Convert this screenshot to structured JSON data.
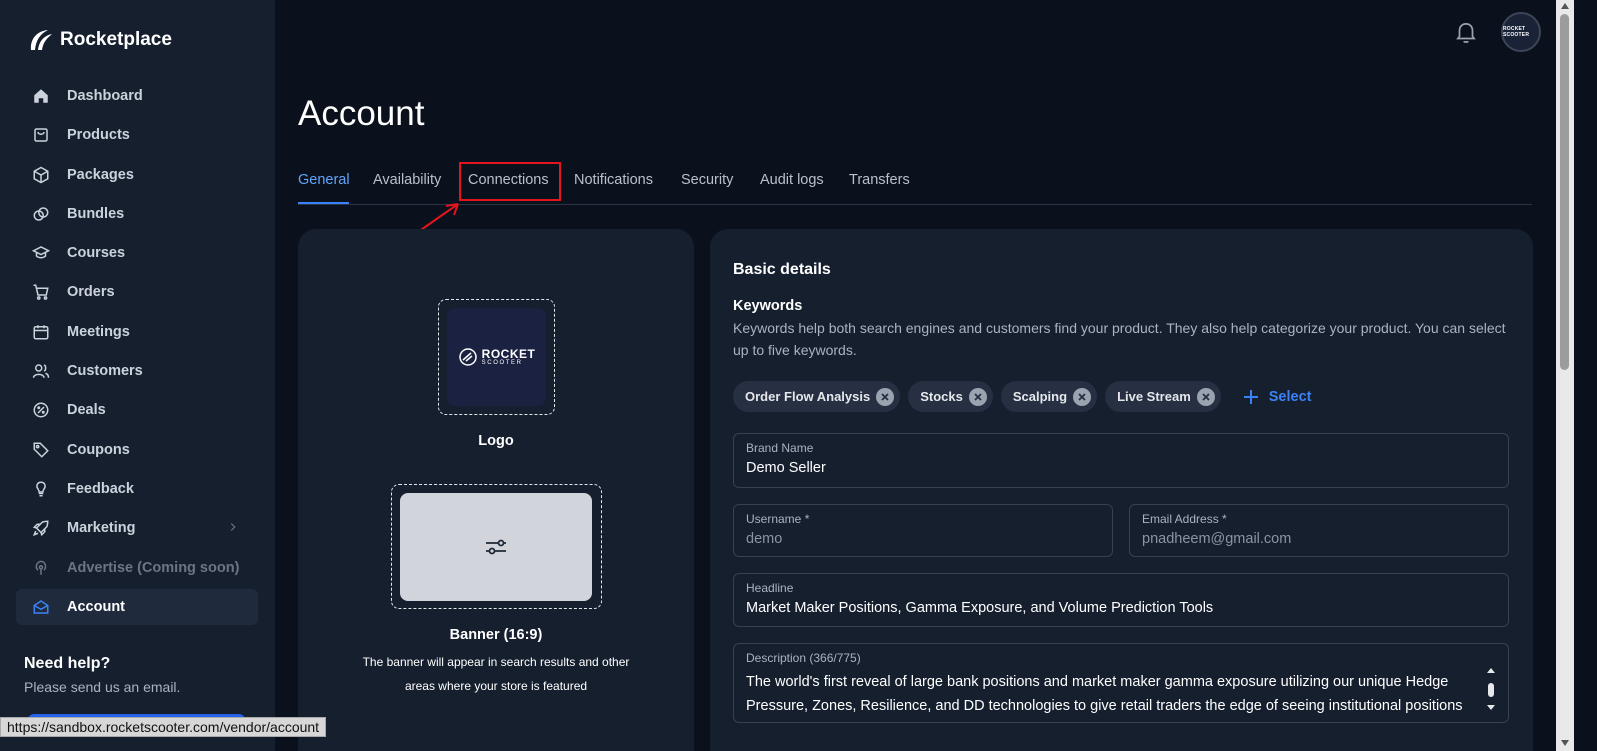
{
  "app": {
    "name": "Rocketplace"
  },
  "sidebar": {
    "items": [
      {
        "label": "Dashboard",
        "icon": "home-icon"
      },
      {
        "label": "Products",
        "icon": "shopping-bag-icon"
      },
      {
        "label": "Packages",
        "icon": "cube-icon"
      },
      {
        "label": "Bundles",
        "icon": "link-icon"
      },
      {
        "label": "Courses",
        "icon": "graduation-cap-icon"
      },
      {
        "label": "Orders",
        "icon": "cart-icon"
      },
      {
        "label": "Meetings",
        "icon": "calendar-icon"
      },
      {
        "label": "Customers",
        "icon": "users-icon"
      },
      {
        "label": "Deals",
        "icon": "percent-icon"
      },
      {
        "label": "Coupons",
        "icon": "tag-icon"
      },
      {
        "label": "Feedback",
        "icon": "lightbulb-icon"
      },
      {
        "label": "Marketing",
        "icon": "rocket-icon"
      },
      {
        "label": "Advertise (Coming soon)",
        "icon": "broadcast-icon"
      },
      {
        "label": "Account",
        "icon": "envelope-open-icon"
      }
    ],
    "help": {
      "title": "Need help?",
      "text": "Please send us an email."
    }
  },
  "topbar": {
    "avatar_text": "ROCKET SCOOTER"
  },
  "page": {
    "title": "Account",
    "tabs": [
      {
        "label": "General",
        "active": true
      },
      {
        "label": "Availability"
      },
      {
        "label": "Connections"
      },
      {
        "label": "Notifications"
      },
      {
        "label": "Security"
      },
      {
        "label": "Audit logs"
      },
      {
        "label": "Transfers"
      }
    ]
  },
  "media": {
    "logo_brand_top": "ROCKET",
    "logo_brand_bottom": "SCOOTER",
    "logo_label": "Logo",
    "banner_label": "Banner (16:9)",
    "banner_help": "The banner will appear in search results and other areas where your store is featured"
  },
  "basic": {
    "title": "Basic details",
    "keywords_title": "Keywords",
    "keywords_help": "Keywords help both search engines and customers find your product. They also help categorize your product. You can select up to five keywords.",
    "keywords": [
      "Order Flow Analysis",
      "Stocks",
      "Scalping",
      "Live Stream"
    ],
    "select_label": "Select",
    "brand_name": {
      "label": "Brand Name",
      "value": "Demo Seller"
    },
    "username": {
      "label": "Username *",
      "value": "demo"
    },
    "email": {
      "label": "Email Address *",
      "value": "pnadheem@gmail.com"
    },
    "headline": {
      "label": "Headline",
      "value": "Market Maker Positions, Gamma Exposure, and Volume Prediction Tools"
    },
    "description": {
      "label": "Description (366/775)",
      "value": "The world's first reveal of large bank positions and market maker gamma exposure utilizing our unique Hedge Pressure, Zones, Resilience, and DD technologies to give retail traders the edge of seeing institutional positions"
    }
  },
  "status_bar": {
    "url": "https://sandbox.rocketscooter.com/vendor/account"
  },
  "colors": {
    "accent": "#3b82f6",
    "highlight": "#e3141c",
    "background": "#0b111c",
    "panel": "#151f2e"
  }
}
